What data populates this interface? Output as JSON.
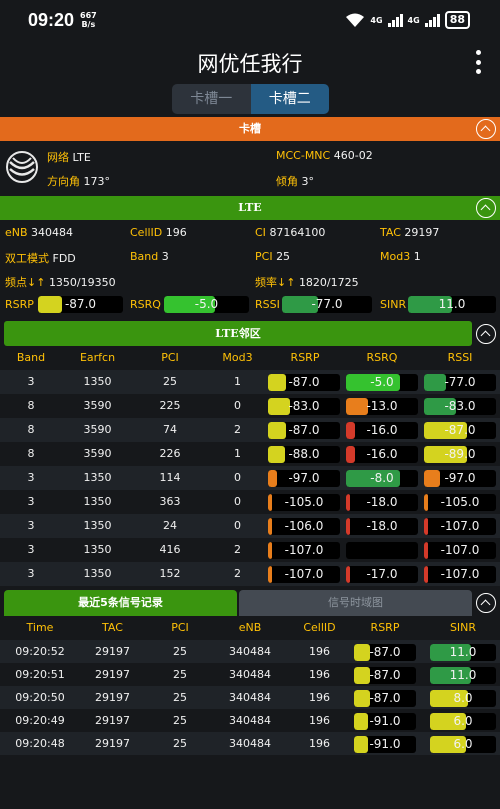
{
  "status_bar": {
    "time": "09:20",
    "net_speed_value": "667",
    "net_speed_unit": "B/s",
    "network1": "4G",
    "network2": "4G",
    "battery": "88"
  },
  "app_title": "网优任我行",
  "sim_tabs": [
    "卡槽一",
    "卡槽二"
  ],
  "slot_section": {
    "title": "卡槽",
    "network_label": "网络",
    "network_value": "LTE",
    "mcc_mnc_label": "MCC-MNC",
    "mcc_mnc_value": "460-02",
    "azimuth_label": "方向角",
    "azimuth_value": "173°",
    "tilt_label": "倾角",
    "tilt_value": "3°"
  },
  "lte_section": {
    "title": "LTE",
    "enb_label": "eNB",
    "enb_value": "340484",
    "cellid_label": "CellID",
    "cellid_value": "196",
    "ci_label": "CI",
    "ci_value": "87164100",
    "tac_label": "TAC",
    "tac_value": "29197",
    "duplex_label": "双工模式",
    "duplex_value": "FDD",
    "band_label": "Band",
    "band_value": "3",
    "pci_label": "PCI",
    "pci_value": "25",
    "mod3_label": "Mod3",
    "mod3_value": "1",
    "earfcn_label": "频点↓↑",
    "earfcn_value": "1350/19350",
    "freq_label": "频率↓↑",
    "freq_value": "1820/1725",
    "rsrp_label": "RSRP",
    "rsrp_value": "-87.0",
    "rsrq_label": "RSRQ",
    "rsrq_value": "-5.0",
    "rssi_label": "RSSI",
    "rssi_value": "-77.0",
    "sinr_label": "SINR",
    "sinr_value": "11.0",
    "meters": [
      {
        "level": 0.28,
        "color": "#d4d31f"
      },
      {
        "level": 0.6,
        "color": "#35c22f"
      },
      {
        "level": 0.4,
        "color": "#2f9a46"
      },
      {
        "level": 0.5,
        "color": "#2f9a46"
      }
    ]
  },
  "neighbor_section": {
    "title": "LTE邻区",
    "headers": [
      "Band",
      "Earfcn",
      "PCI",
      "Mod3",
      "RSRP",
      "RSRQ",
      "RSSI"
    ],
    "rows": [
      {
        "band": "3",
        "earfcn": "1350",
        "pci": "25",
        "mod3": "1",
        "rsrp": "-87.0",
        "rsrq": "-5.0",
        "rssi": "-77.0"
      },
      {
        "band": "8",
        "earfcn": "3590",
        "pci": "225",
        "mod3": "0",
        "rsrp": "-83.0",
        "rsrq": "-13.0",
        "rssi": "-83.0"
      },
      {
        "band": "8",
        "earfcn": "3590",
        "pci": "74",
        "mod3": "2",
        "rsrp": "-87.0",
        "rsrq": "-16.0",
        "rssi": "-87.0"
      },
      {
        "band": "8",
        "earfcn": "3590",
        "pci": "226",
        "mod3": "1",
        "rsrp": "-88.0",
        "rsrq": "-16.0",
        "rssi": "-89.0"
      },
      {
        "band": "3",
        "earfcn": "1350",
        "pci": "114",
        "mod3": "0",
        "rsrp": "-97.0",
        "rsrq": "-8.0",
        "rssi": "-97.0"
      },
      {
        "band": "3",
        "earfcn": "1350",
        "pci": "363",
        "mod3": "0",
        "rsrp": "-105.0",
        "rsrq": "-18.0",
        "rssi": "-105.0"
      },
      {
        "band": "3",
        "earfcn": "1350",
        "pci": "24",
        "mod3": "0",
        "rsrp": "-106.0",
        "rsrq": "-18.0",
        "rssi": "-107.0"
      },
      {
        "band": "3",
        "earfcn": "1350",
        "pci": "416",
        "mod3": "2",
        "rsrp": "-107.0",
        "rsrq": "",
        "rssi": "-107.0"
      },
      {
        "band": "3",
        "earfcn": "1350",
        "pci": "152",
        "mod3": "2",
        "rsrp": "-107.0",
        "rsrq": "-17.0",
        "rssi": "-107.0"
      }
    ],
    "meter_levels": [
      {
        "rsrp": [
          0.25,
          "#d4d31f"
        ],
        "rsrq": [
          0.75,
          "#35c22f"
        ],
        "rssi": [
          0.3,
          "#2f9a46"
        ]
      },
      {
        "rsrp": [
          0.3,
          "#d4d31f"
        ],
        "rsrq": [
          0.3,
          "#e87e1c"
        ],
        "rssi": [
          0.45,
          "#2f9a46"
        ]
      },
      {
        "rsrp": [
          0.25,
          "#d4d31f"
        ],
        "rsrq": [
          0.12,
          "#d43a2a"
        ],
        "rssi": [
          0.6,
          "#d4d31f"
        ]
      },
      {
        "rsrp": [
          0.24,
          "#d4d31f"
        ],
        "rsrq": [
          0.12,
          "#d43a2a"
        ],
        "rssi": [
          0.6,
          "#d4d31f"
        ]
      },
      {
        "rsrp": [
          0.12,
          "#e87e1c"
        ],
        "rsrq": [
          0.75,
          "#2f9a46"
        ],
        "rssi": [
          0.22,
          "#e87e1c"
        ]
      },
      {
        "rsrp": [
          0.04,
          "#e87e1c"
        ],
        "rsrq": [
          0.04,
          "#d43a2a"
        ],
        "rssi": [
          0.05,
          "#e87e1c"
        ]
      },
      {
        "rsrp": [
          0.04,
          "#e87e1c"
        ],
        "rsrq": [
          0.04,
          "#d43a2a"
        ],
        "rssi": [
          0.05,
          "#d43a2a"
        ]
      },
      {
        "rsrp": [
          0.04,
          "#e87e1c"
        ],
        "rsrq": [
          0.0,
          "#d43a2a"
        ],
        "rssi": [
          0.05,
          "#d43a2a"
        ]
      },
      {
        "rsrp": [
          0.04,
          "#e87e1c"
        ],
        "rsrq": [
          0.04,
          "#d43a2a"
        ],
        "rssi": [
          0.05,
          "#d43a2a"
        ]
      }
    ]
  },
  "records_section": {
    "tab_active": "最近5条信号记录",
    "tab_inactive": "信号时域图",
    "headers": [
      "Time",
      "TAC",
      "PCI",
      "eNB",
      "CellID",
      "RSRP",
      "SINR"
    ],
    "rows": [
      {
        "time": "09:20:52",
        "tac": "29197",
        "pci": "25",
        "enb": "340484",
        "cellid": "196",
        "rsrp": "-87.0",
        "sinr": "11.0"
      },
      {
        "time": "09:20:51",
        "tac": "29197",
        "pci": "25",
        "enb": "340484",
        "cellid": "196",
        "rsrp": "-87.0",
        "sinr": "11.0"
      },
      {
        "time": "09:20:50",
        "tac": "29197",
        "pci": "25",
        "enb": "340484",
        "cellid": "196",
        "rsrp": "-87.0",
        "sinr": "8.0"
      },
      {
        "time": "09:20:49",
        "tac": "29197",
        "pci": "25",
        "enb": "340484",
        "cellid": "196",
        "rsrp": "-91.0",
        "sinr": "6.0"
      },
      {
        "time": "09:20:48",
        "tac": "29197",
        "pci": "25",
        "enb": "340484",
        "cellid": "196",
        "rsrp": "-91.0",
        "sinr": "6.0"
      }
    ],
    "meter_levels": [
      {
        "rsrp": [
          0.25,
          "#d4d31f"
        ],
        "sinr": [
          0.62,
          "#2f9a46"
        ]
      },
      {
        "rsrp": [
          0.25,
          "#d4d31f"
        ],
        "sinr": [
          0.62,
          "#2f9a46"
        ]
      },
      {
        "rsrp": [
          0.25,
          "#d4d31f"
        ],
        "sinr": [
          0.58,
          "#d4d31f"
        ]
      },
      {
        "rsrp": [
          0.22,
          "#d4d31f"
        ],
        "sinr": [
          0.55,
          "#d4d31f"
        ]
      },
      {
        "rsrp": [
          0.22,
          "#d4d31f"
        ],
        "sinr": [
          0.55,
          "#d4d31f"
        ]
      }
    ]
  }
}
